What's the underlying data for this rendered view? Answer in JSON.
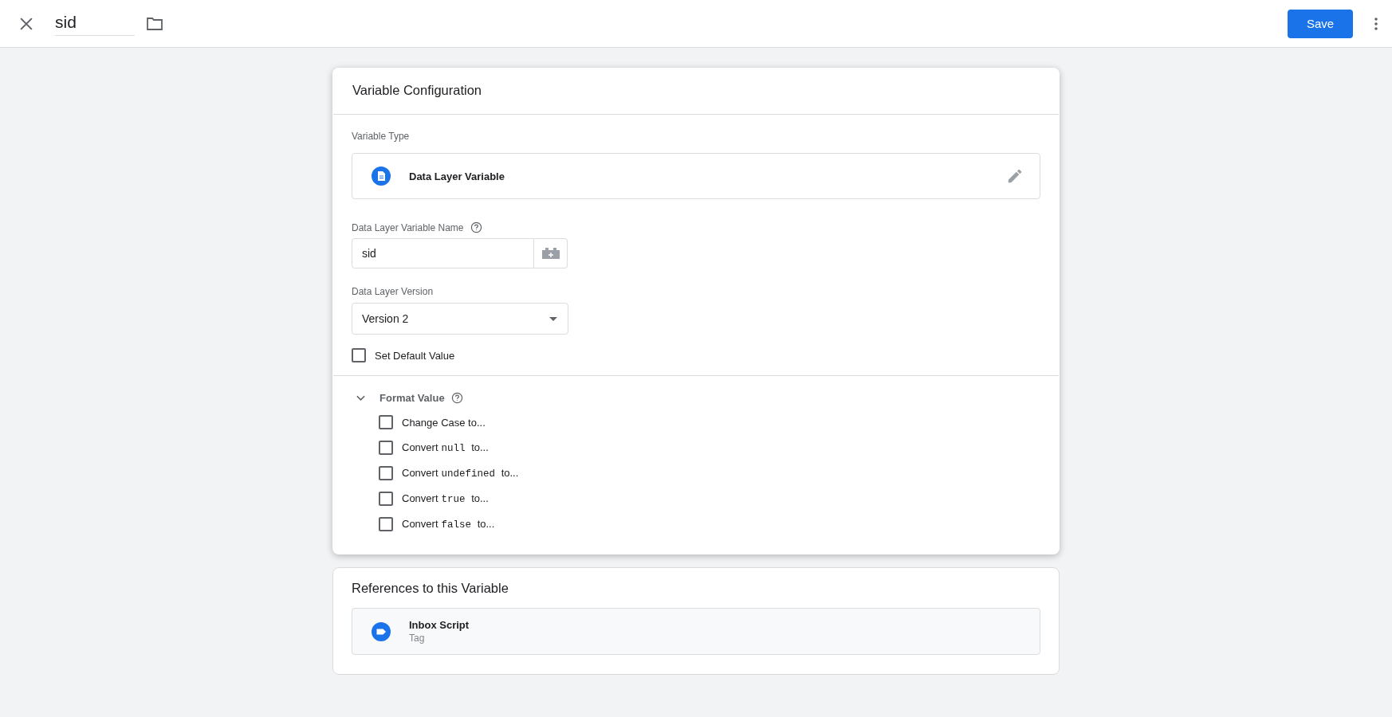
{
  "header": {
    "name_value": "sid",
    "save_label": "Save"
  },
  "config": {
    "title": "Variable Configuration",
    "type_label": "Variable Type",
    "type_name": "Data Layer Variable",
    "name_label": "Data Layer Variable Name",
    "name_value": "sid",
    "version_label": "Data Layer Version",
    "version_value": "Version 2",
    "default_value": {
      "label": "Set Default Value",
      "checked": false
    },
    "format": {
      "label": "Format Value",
      "expanded": true,
      "options": [
        {
          "text": "Change Case to...",
          "checked": false
        },
        {
          "text": "Convert",
          "code": "null",
          "suffix": "to...",
          "checked": false
        },
        {
          "text": "Convert",
          "code": "undefined",
          "suffix": "to...",
          "checked": false
        },
        {
          "text": "Convert",
          "code": "true",
          "suffix": "to...",
          "checked": false
        },
        {
          "text": "Convert",
          "code": "false",
          "suffix": "to...",
          "checked": false
        }
      ]
    }
  },
  "references": {
    "title": "References to this Variable",
    "items": [
      {
        "name": "Inbox Script",
        "type": "Tag"
      }
    ]
  }
}
